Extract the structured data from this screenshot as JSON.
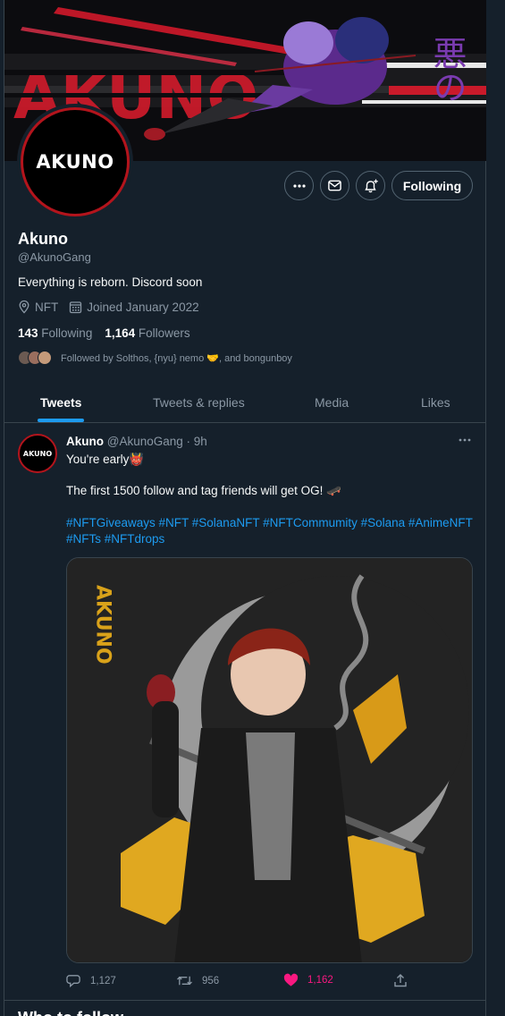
{
  "banner": {
    "wordmark": "AKUNO",
    "kanji": "悪の"
  },
  "profile": {
    "avatar_text": "AKUNO",
    "name": "Akuno",
    "handle": "@AkunoGang",
    "bio": "Everything is reborn. Discord soon",
    "location": "NFT",
    "joined": "Joined January 2022",
    "following_count": "143",
    "following_label": "Following",
    "followers_count": "1,164",
    "followers_label": "Followers",
    "followed_by": "Followed by Solthos, {nyu} nemo 🤝, and bongunboy",
    "icons": [
      "more-icon",
      "message-icon",
      "notification-add-icon",
      "location-icon",
      "calendar-icon"
    ]
  },
  "actions": {
    "follow_label": "Following"
  },
  "tabs": [
    {
      "label": "Tweets",
      "active": true
    },
    {
      "label": "Tweets & replies",
      "active": false
    },
    {
      "label": "Media",
      "active": false
    },
    {
      "label": "Likes",
      "active": false
    }
  ],
  "tweet": {
    "avatar_text": "AKUNO",
    "name": "Akuno",
    "handle_time": "@AkunoGang · 9h",
    "line1": "You're early👹",
    "line2": "The first 1500 follow and tag friends will get OG! 🛹",
    "hashtags": "#NFTGiveaways #NFT #SolanaNFT #NFTCommumity #Solana #AnimeNFT #NFTs #NFTdrops",
    "media_text": "AKUNO",
    "replies": "1,127",
    "retweets": "956",
    "likes": "1,162",
    "liked": true
  },
  "next_section": {
    "title": "Who to follow"
  },
  "colors": {
    "background": "#15202b",
    "accent": "#1d9bf0",
    "like": "#f91880",
    "brand_red": "#b3141c",
    "muted": "#8b98a5"
  }
}
